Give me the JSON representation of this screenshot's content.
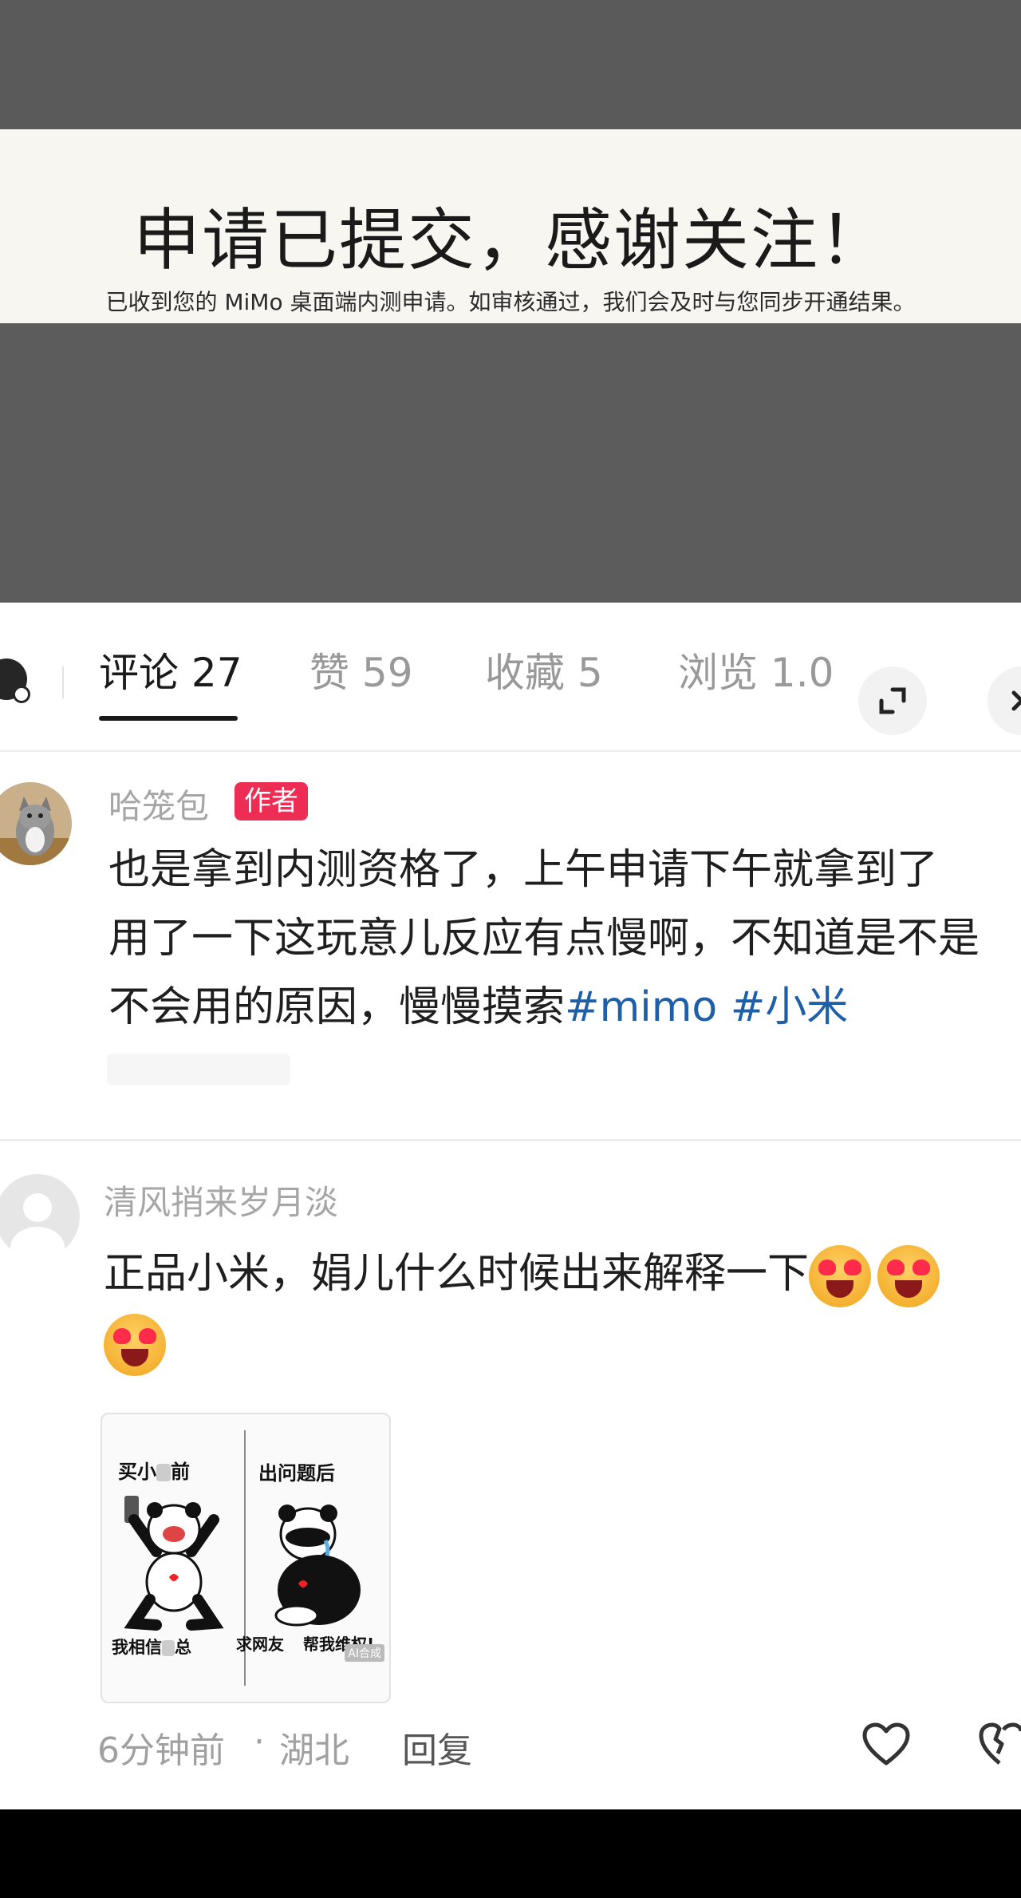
{
  "banner": {
    "title": "申请已提交，感谢关注！",
    "subtitle": "已收到您的 MiMo 桌面端内测申请。如审核通过，我们会及时与您同步开通结果。"
  },
  "tabs": [
    {
      "label": "评论 27",
      "active": true
    },
    {
      "label": "赞 59",
      "active": false
    },
    {
      "label": "收藏 5",
      "active": false
    },
    {
      "label": "浏览 1.0",
      "active": false
    }
  ],
  "icons": {
    "left": "user-settings-icon",
    "expand": "expand-icon",
    "close": "close-icon",
    "like": "heart-icon",
    "dislike": "broken-heart-icon"
  },
  "comments": [
    {
      "author": "哈笼包",
      "badge": "作者",
      "lines": [
        "也是拿到内测资格了，上午申请下午就拿到了",
        "用了一下这玩意儿反应有点慢啊，不知道是不是",
        "不会用的原因，慢慢摸索"
      ],
      "hashtags": [
        "#mimo",
        "#小米"
      ]
    },
    {
      "author": "清风捎来岁月淡",
      "text": "正品小米，娟儿什么时候出来解释一下",
      "meme": {
        "left_top": "买小",
        "left_top_end": "前",
        "right_top": "出问题后",
        "left_bottom_a": "我相信",
        "left_bottom_b": "总",
        "right_bottom_a": "求网友",
        "right_bottom_b": "帮我维权!",
        "watermark": "AI合成"
      },
      "time": "6分钟前",
      "dot": "·",
      "location": "湖北",
      "reply": "回复"
    }
  ],
  "colors": {
    "badge": "#ee2d54",
    "hashtag": "#1d5fa8"
  }
}
